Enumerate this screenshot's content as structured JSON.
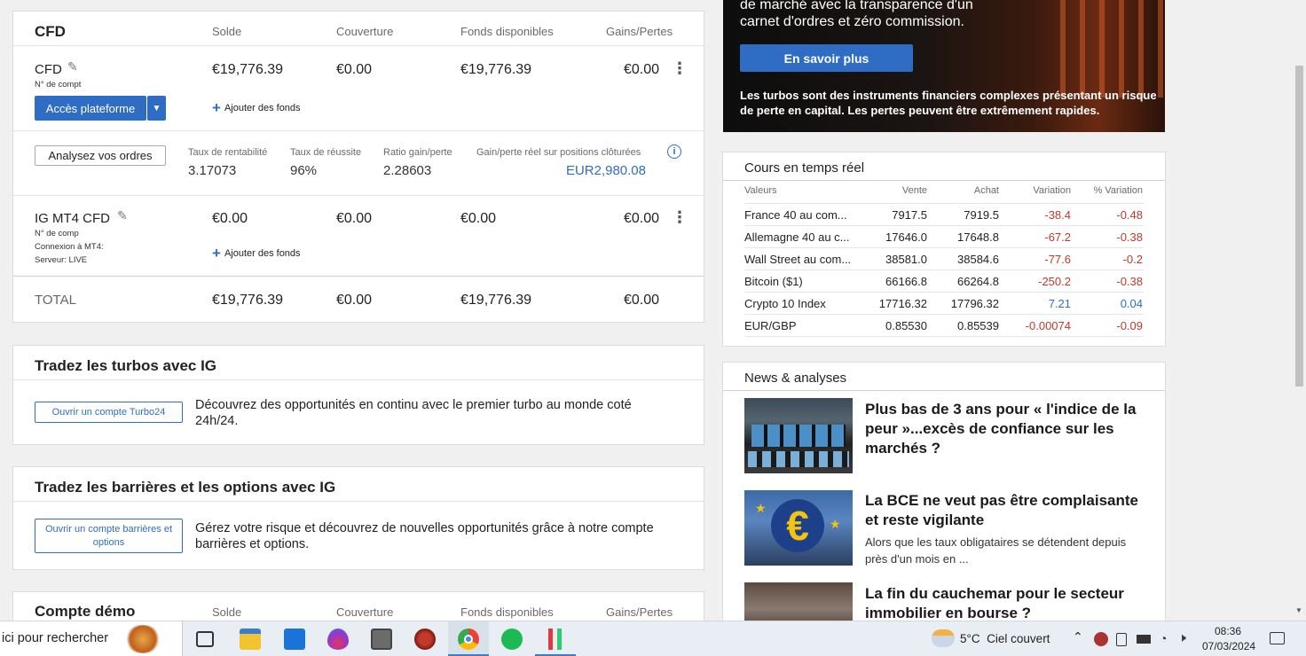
{
  "cfd_card": {
    "title": "CFD",
    "cols": {
      "solde": "Solde",
      "couverture": "Couverture",
      "fonds": "Fonds disponibles",
      "gains": "Gains/Pertes"
    },
    "account1": {
      "name": "CFD",
      "sub": "N° de compt",
      "solde": "€19,776.39",
      "couverture": "€0.00",
      "fonds": "€19,776.39",
      "gains": "€0.00",
      "platform_btn": "Accès plateforme",
      "add_funds": "Ajouter des fonds"
    },
    "analysis": {
      "btn": "Analysez vos ordres",
      "stats": [
        {
          "label": "Taux de rentabilité",
          "value": "3.17073"
        },
        {
          "label": "Taux de réussite",
          "value": "96%"
        },
        {
          "label": "Ratio gain/perte",
          "value": "2.28603"
        },
        {
          "label": "Gain/perte réel sur positions clôturées",
          "value": "EUR2,980.08"
        }
      ]
    },
    "account2": {
      "name": "IG MT4 CFD",
      "sub1": "N° de comp",
      "sub2": "Connexion à MT4:",
      "sub3": "Serveur: LIVE",
      "solde": "€0.00",
      "couverture": "€0.00",
      "fonds": "€0.00",
      "gains": "€0.00",
      "add_funds": "Ajouter des fonds"
    },
    "total": {
      "label": "TOTAL",
      "solde": "€19,776.39",
      "couverture": "€0.00",
      "fonds": "€19,776.39",
      "gains": "€0.00"
    }
  },
  "turbos": {
    "title": "Tradez les turbos avec IG",
    "btn": "Ouvrir un compte Turbo24",
    "text": "Découvrez des opportunités en continu avec le premier turbo au monde coté 24h/24."
  },
  "barriers": {
    "title": "Tradez les barrières et les options avec IG",
    "btn": "Ouvrir un compte barrières et options",
    "text": "Gérez votre risque et découvrez de nouvelles opportunités grâce à notre compte barrières et options."
  },
  "demo": {
    "title": "Compte démo",
    "cols": {
      "solde": "Solde",
      "couverture": "Couverture",
      "fonds": "Fonds disponibles",
      "gains": "Gains/Pertes"
    }
  },
  "promo": {
    "line1": "de marché avec la transparence d'un",
    "line2": "carnet d'ordres et zéro commission.",
    "btn": "En savoir plus",
    "disclaimer": "Les turbos sont des instruments financiers complexes présentant un risque de perte en capital. Les pertes peuvent être extrêmement rapides."
  },
  "quotes": {
    "title": "Cours en temps réel",
    "headers": [
      "Valeurs",
      "Vente",
      "Achat",
      "Variation",
      "% Variation"
    ],
    "rows": [
      {
        "name": "France 40 au com...",
        "sell": "7917.5",
        "buy": "7919.5",
        "var": "-38.4",
        "pct": "-0.48",
        "dir": "neg"
      },
      {
        "name": "Allemagne 40 au c...",
        "sell": "17646.0",
        "buy": "17648.8",
        "var": "-67.2",
        "pct": "-0.38",
        "dir": "neg"
      },
      {
        "name": "Wall Street au com...",
        "sell": "38581.0",
        "buy": "38584.6",
        "var": "-77.6",
        "pct": "-0.2",
        "dir": "neg"
      },
      {
        "name": "Bitcoin ($1)",
        "sell": "66166.8",
        "buy": "66264.8",
        "var": "-250.2",
        "pct": "-0.38",
        "dir": "neg"
      },
      {
        "name": "Crypto 10 Index",
        "sell": "17716.32",
        "buy": "17796.32",
        "var": "7.21",
        "pct": "0.04",
        "dir": "pos"
      },
      {
        "name": "EUR/GBP",
        "sell": "0.85530",
        "buy": "0.85539",
        "var": "-0.00074",
        "pct": "-0.09",
        "dir": "neg"
      }
    ]
  },
  "news": {
    "title": "News & analyses",
    "items": [
      {
        "title": "Plus bas de 3 ans pour « l'indice de la peur »...excès de confiance sur les marchés ?",
        "summary": ""
      },
      {
        "title": "La BCE ne veut pas être complaisante et reste vigilante",
        "summary": "Alors que les taux obligataires se détendent depuis près d'un mois en ..."
      },
      {
        "title": "La fin du cauchemar pour le secteur immobilier en bourse ?",
        "summary": ""
      }
    ]
  },
  "taskbar": {
    "search": "ici pour rechercher",
    "weather": "5°C  Ciel couvert",
    "time": "08:36",
    "date": "07/03/2024"
  }
}
